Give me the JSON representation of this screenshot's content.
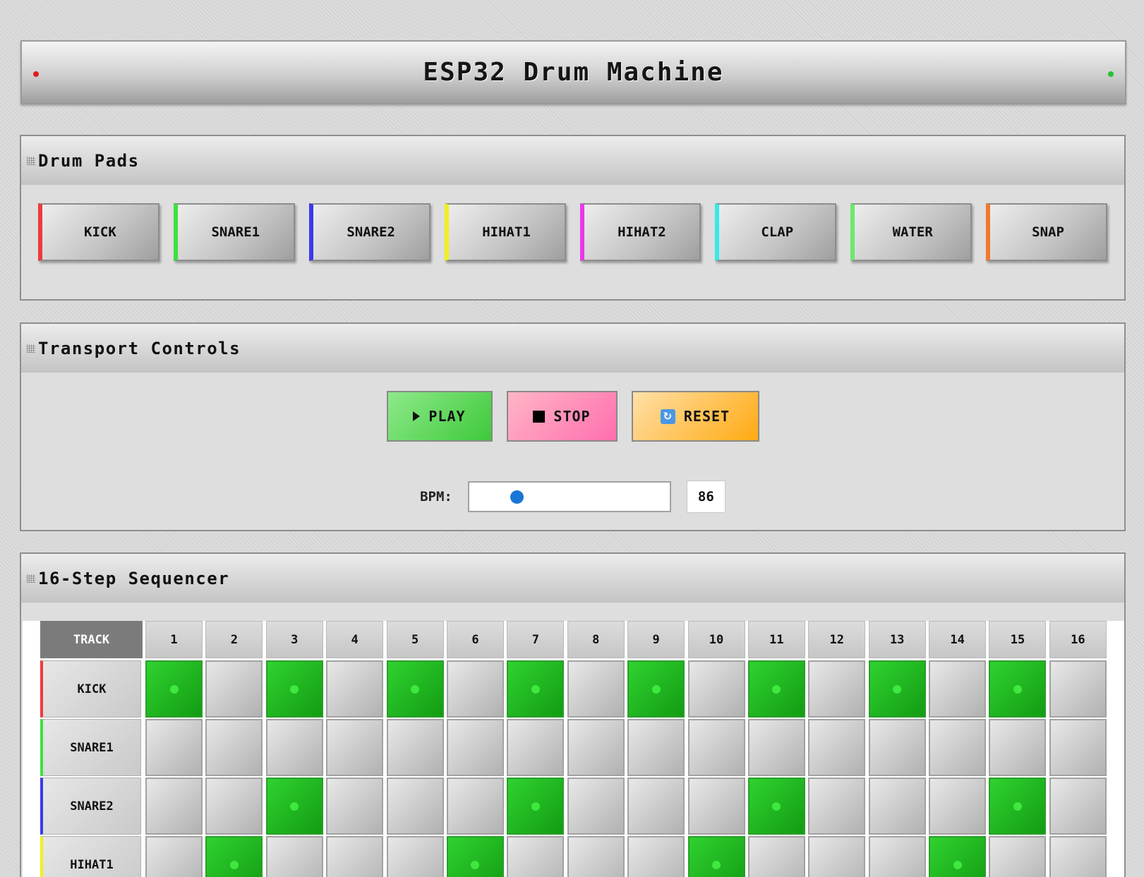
{
  "app": {
    "title": "ESP32 Drum Machine"
  },
  "pads_panel": {
    "title": "Drum Pads",
    "pads": [
      {
        "label": "KICK",
        "color": "#ee3a3a"
      },
      {
        "label": "SNARE1",
        "color": "#3ee03e"
      },
      {
        "label": "SNARE2",
        "color": "#3a3ae8"
      },
      {
        "label": "HIHAT1",
        "color": "#f0f020"
      },
      {
        "label": "HIHAT2",
        "color": "#e83ae8"
      },
      {
        "label": "CLAP",
        "color": "#3ae8e8"
      },
      {
        "label": "WATER",
        "color": "#6ee86e"
      },
      {
        "label": "SNAP",
        "color": "#f07830"
      }
    ]
  },
  "transport": {
    "title": "Transport Controls",
    "play_label": "PLAY",
    "stop_label": "STOP",
    "reset_label": "RESET",
    "play_icon": "play-triangle-icon",
    "stop_icon": "stop-square-icon",
    "reset_icon": "refresh-icon",
    "bpm_label": "BPM:",
    "bpm_value": "86",
    "bpm_slider_fraction": 0.2
  },
  "sequencer": {
    "title": "16-Step Sequencer",
    "track_header": "TRACK",
    "step_headers": [
      "1",
      "2",
      "3",
      "4",
      "5",
      "6",
      "7",
      "8",
      "9",
      "10",
      "11",
      "12",
      "13",
      "14",
      "15",
      "16"
    ],
    "tracks": [
      {
        "name": "KICK",
        "color": "#ee3a3a",
        "steps": [
          1,
          0,
          1,
          0,
          1,
          0,
          1,
          0,
          1,
          0,
          1,
          0,
          1,
          0,
          1,
          0
        ]
      },
      {
        "name": "SNARE1",
        "color": "#3ee03e",
        "steps": [
          0,
          0,
          0,
          0,
          0,
          0,
          0,
          0,
          0,
          0,
          0,
          0,
          0,
          0,
          0,
          0
        ]
      },
      {
        "name": "SNARE2",
        "color": "#3a3ae8",
        "steps": [
          0,
          0,
          1,
          0,
          0,
          0,
          1,
          0,
          0,
          0,
          1,
          0,
          0,
          0,
          1,
          0
        ]
      },
      {
        "name": "HIHAT1",
        "color": "#f0f020",
        "steps": [
          0,
          1,
          0,
          0,
          0,
          1,
          0,
          0,
          0,
          1,
          0,
          0,
          0,
          1,
          0,
          0
        ]
      }
    ]
  }
}
